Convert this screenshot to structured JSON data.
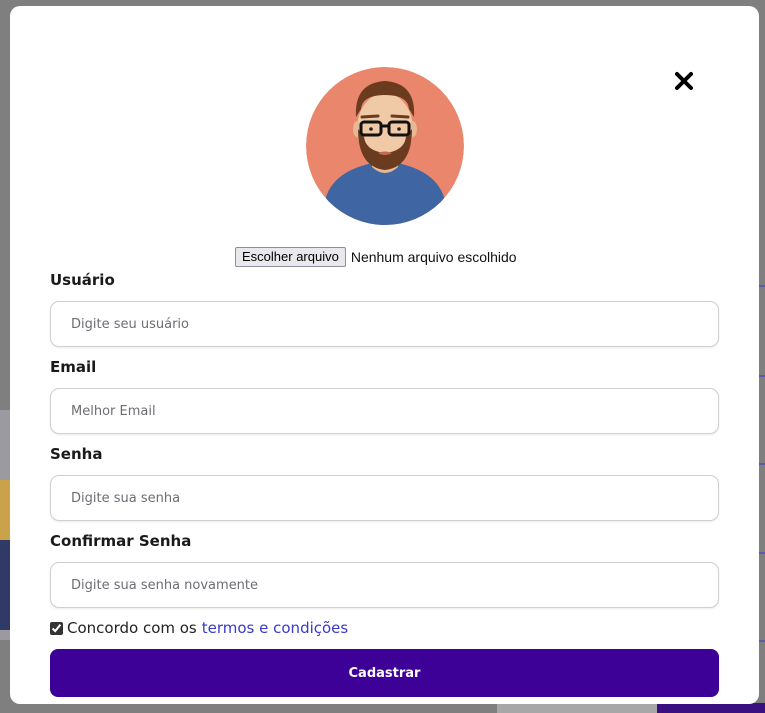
{
  "modal": {
    "close_icon": "close-icon",
    "avatar_icon": "user-avatar-illustration",
    "file_input": {
      "button_label": "Escolher arquivo",
      "status": "Nenhum arquivo escolhido"
    },
    "fields": [
      {
        "label": "Usuário",
        "placeholder": "Digite seu usuário"
      },
      {
        "label": "Email",
        "placeholder": "Melhor Email"
      },
      {
        "label": "Senha",
        "placeholder": "Digite sua senha"
      },
      {
        "label": "Confirmar Senha",
        "placeholder": "Digite sua senha novamente"
      }
    ],
    "terms": {
      "checked": true,
      "text": "Concordo com os",
      "link": "termos e condições"
    },
    "submit_label": "Cadastrar"
  },
  "colors": {
    "primary": "#3e0197",
    "link": "#3a3ac9",
    "avatar_bg": "#e9866b",
    "overlay": "#7f7f80"
  }
}
